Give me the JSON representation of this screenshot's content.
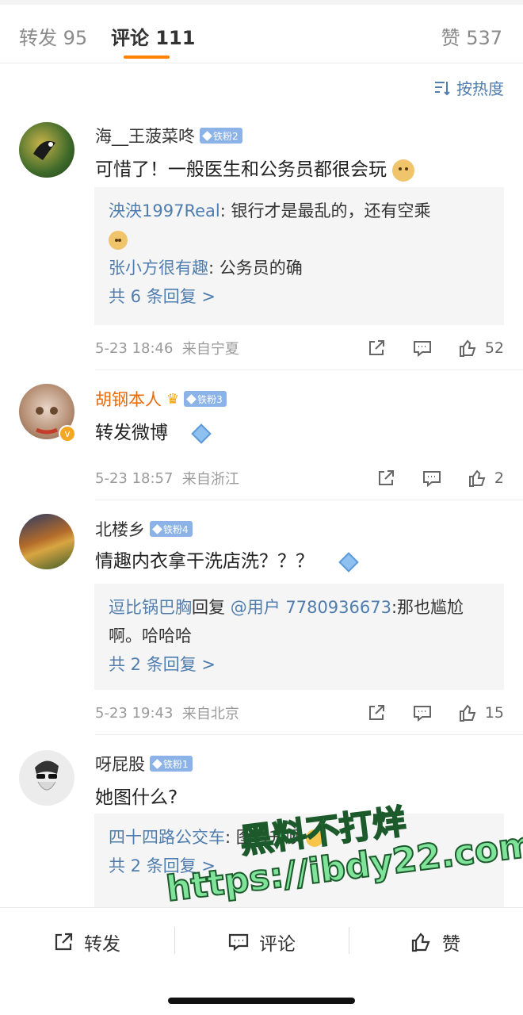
{
  "tabs": {
    "repost": "转发 95",
    "comments": "评论 111",
    "likes": "赞 537"
  },
  "sort": {
    "label": "按热度"
  },
  "comments": [
    {
      "username": "海__王菠菜咚",
      "badge": "铁粉2",
      "content": "可惜了！一般医生和公务员都很会玩",
      "replies": [
        {
          "author": "泱泱1997Real",
          "text": ": 银行才是最乱的，还有空乘"
        },
        {
          "author": "张小方很有趣",
          "text": ": 公务员的确"
        }
      ],
      "more": "共 6 条回复 >",
      "time": "5-23 18:46",
      "location": "来自宁夏",
      "likes": "52"
    },
    {
      "username": "胡钢本人",
      "badge": "铁粉3",
      "content": "转发微博",
      "time": "5-23 18:57",
      "location": "来自浙江",
      "likes": "2"
    },
    {
      "username": "北楼乡",
      "badge": "铁粉4",
      "content": "情趣内衣拿干洗店洗？？？",
      "replies": [
        {
          "author": "逗比锅巴胸",
          "text": "回复 ",
          "mention": "@用户 7780936673",
          "tail": ":那也尴尬啊。哈哈哈"
        }
      ],
      "more": "共 2 条回复 >",
      "time": "5-23 19:43",
      "location": "来自北京",
      "likes": "15"
    },
    {
      "username": "呀屁股",
      "badge": "铁粉1",
      "content": "她图什么?",
      "replies": [
        {
          "author": "四十四路公交车",
          "text": ": 图晋升呗"
        }
      ],
      "more": "共 2 条回复 >"
    }
  ],
  "bottom_bar": {
    "repost": "转发",
    "comment": "评论",
    "like": "赞"
  },
  "watermark": {
    "line1": "黑料不打烊",
    "line2": "https://ibdy22.com"
  },
  "colors": {
    "accent": "#ff8200",
    "link": "#507daf",
    "badge": "#8bb3e8"
  }
}
